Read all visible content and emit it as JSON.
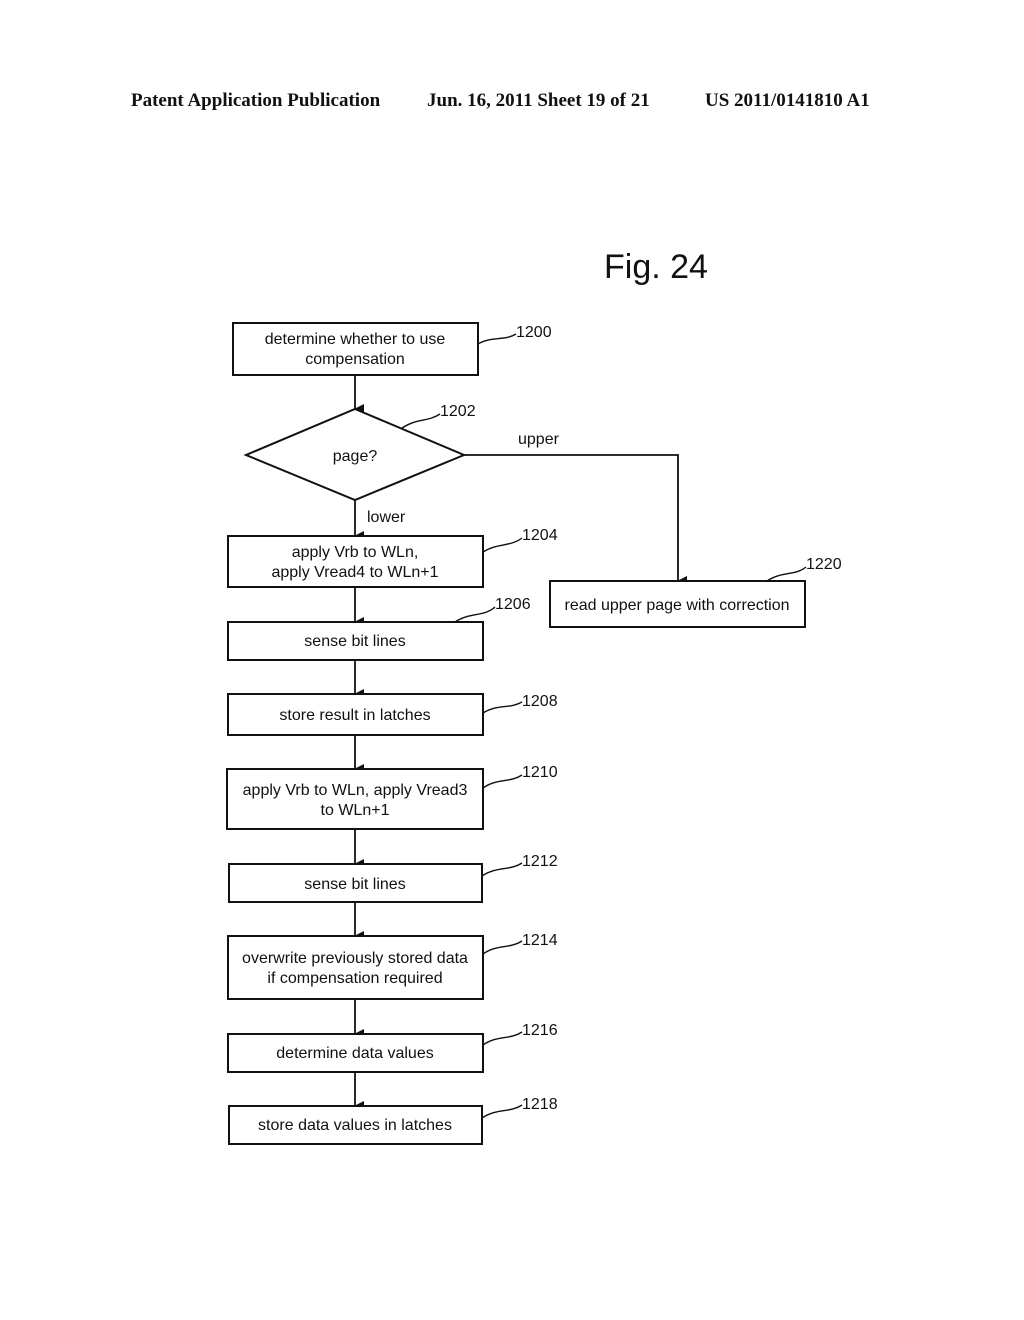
{
  "header": {
    "publication": "Patent Application Publication",
    "date_sheet": "Jun. 16, 2011  Sheet 19 of 21",
    "number": "US 2011/0141810 A1"
  },
  "figure_title": "Fig. 24",
  "steps": {
    "s1200": {
      "ref": "1200",
      "line1": "determine whether to use",
      "line2": "compensation"
    },
    "s1202": {
      "ref": "1202",
      "text": "page?",
      "branch_upper": "upper",
      "branch_lower": "lower"
    },
    "s1204": {
      "ref": "1204",
      "line1": "apply Vrb to WLn,",
      "line2": "apply Vread4 to WLn+1"
    },
    "s1206": {
      "ref": "1206",
      "text": "sense bit lines"
    },
    "s1208": {
      "ref": "1208",
      "text": "store result in latches"
    },
    "s1210": {
      "ref": "1210",
      "line1": "apply Vrb to WLn, apply Vread3",
      "line2": "to WLn+1"
    },
    "s1212": {
      "ref": "1212",
      "text": "sense bit lines"
    },
    "s1214": {
      "ref": "1214",
      "line1": "overwrite previously stored data",
      "line2": "if compensation required"
    },
    "s1216": {
      "ref": "1216",
      "text": "determine data values"
    },
    "s1218": {
      "ref": "1218",
      "text": "store data values in latches"
    },
    "s1220": {
      "ref": "1220",
      "text": "read upper page with correction"
    }
  }
}
